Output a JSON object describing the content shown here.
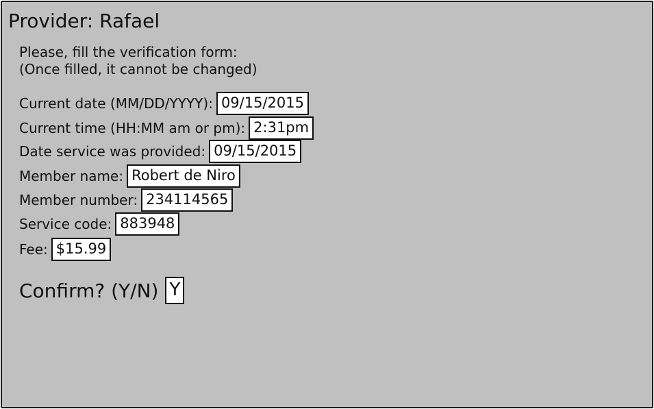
{
  "window": {
    "title": "Provider: Rafael"
  },
  "instructions": {
    "line1": "Please, fill the verification form:",
    "line2": "(Once filled, it cannot be changed)"
  },
  "form": {
    "current_date": {
      "label": "Current date (MM/DD/YYYY):",
      "value": "09/15/2015"
    },
    "current_time": {
      "label": "Current time (HH:MM am or pm):",
      "value": "2:31pm"
    },
    "service_date": {
      "label": "Date service was provided:",
      "value": "09/15/2015"
    },
    "member_name": {
      "label": "Member name:",
      "value": "Robert de Niro"
    },
    "member_number": {
      "label": "Member number:",
      "value": "234114565"
    },
    "service_code": {
      "label": "Service code:",
      "value": "883948"
    },
    "fee": {
      "label": "Fee:",
      "value": "$15.99"
    },
    "confirm": {
      "label": "Confirm? (Y/N)",
      "value": "Y"
    }
  },
  "colors": {
    "background": "#c0c0c0",
    "field_background": "#ffffff",
    "border": "#111111"
  }
}
